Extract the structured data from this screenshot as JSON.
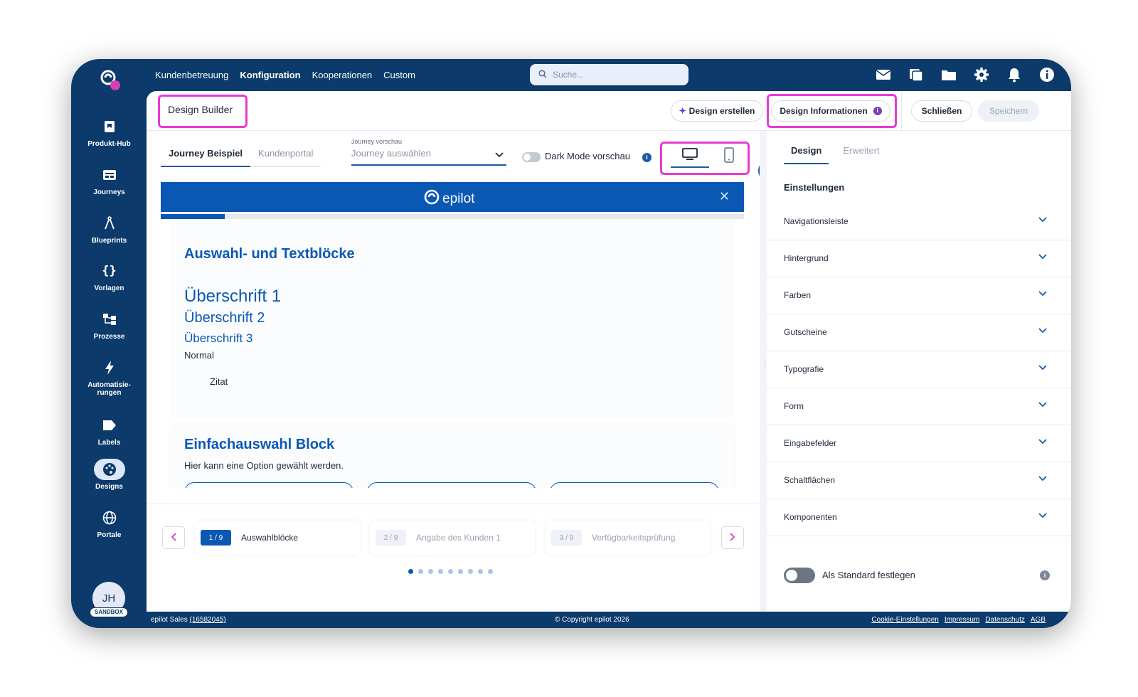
{
  "topnav": {
    "links": [
      "Kundenbetreuung",
      "Konfiguration",
      "Kooperationen",
      "Custom"
    ],
    "active": "Konfiguration",
    "search_placeholder": "Suche...",
    "icons": [
      "mail-icon",
      "cards-icon",
      "folder-icon",
      "gear-icon",
      "bell-icon",
      "info-icon"
    ]
  },
  "sidebar": {
    "items": [
      {
        "label": "Produkt-Hub",
        "icon": "product-hub-icon"
      },
      {
        "label": "Journeys",
        "icon": "journeys-icon"
      },
      {
        "label": "Blueprints",
        "icon": "compass-icon"
      },
      {
        "label": "Vorlagen",
        "icon": "braces-icon"
      },
      {
        "label": "Prozesse",
        "icon": "process-icon"
      },
      {
        "label": "Automatisie-",
        "label2": "rungen",
        "icon": "bolt-icon"
      },
      {
        "label": "Labels",
        "icon": "label-icon"
      },
      {
        "label": "Designs",
        "icon": "palette-icon",
        "active": true
      },
      {
        "label": "Portale",
        "icon": "globe-icon"
      }
    ],
    "avatar_initials": "JH",
    "sandbox_badge": "SANDBOX"
  },
  "header": {
    "title": "Design Builder",
    "create_label": "Design erstellen",
    "info_label": "Design Informationen",
    "close_label": "Schließen",
    "save_label": "Speichern"
  },
  "preview_controls": {
    "tabs": [
      "Journey Beispiel",
      "Kundenportal"
    ],
    "journey_label": "Journey vorschau",
    "journey_placeholder": "Journey auswählen",
    "dark_mode_label": "Dark Mode vorschau"
  },
  "preview": {
    "brand": "epilot",
    "progress": 0.11,
    "section1_title": "Auswahl- und Textblöcke",
    "h1": "Überschrift 1",
    "h2": "Überschrift 2",
    "h3": "Überschrift 3",
    "normal": "Normal",
    "quote": "Zitat",
    "section2_title": "Einfachauswahl Block",
    "section2_text": "Hier kann eine Option gewählt werden."
  },
  "steps": [
    {
      "num": "1 / 9",
      "label": "Auswahlblöcke"
    },
    {
      "num": "2 / 9",
      "label": "Angabe des Kunden 1"
    },
    {
      "num": "3 / 9",
      "label": "Verfügbarkeitsprüfung"
    }
  ],
  "right_panel": {
    "tabs": [
      "Design",
      "Erweitert"
    ],
    "section_title": "Einstellungen",
    "accordion": [
      "Navigationsleiste",
      "Hintergrund",
      "Farben",
      "Gutscheine",
      "Typografie",
      "Form",
      "Eingabefelder",
      "Schaltflächen",
      "Komponenten"
    ],
    "standard_label": "Als Standard festlegen"
  },
  "footer": {
    "account": "epilot Sales",
    "account_id": "(16582045)",
    "copyright": "© Copyright epilot 2026",
    "links": [
      "Cookie-Einstellungen",
      "Impressum",
      "Datenschutz",
      "AGB"
    ]
  }
}
